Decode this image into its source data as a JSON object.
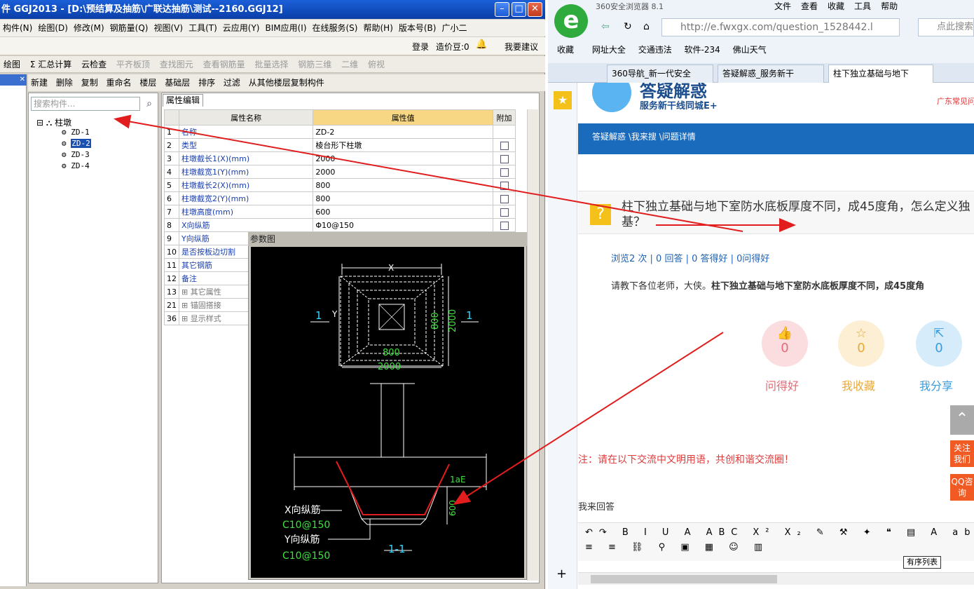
{
  "ggj": {
    "title": "件 GGJ2013 - [D:\\预结算及抽筋\\广联达抽筋\\测试--2160.GGJ12]",
    "menu": [
      "构件(N)",
      "绘图(D)",
      "修改(M)",
      "钢筋量(Q)",
      "视图(V)",
      "工具(T)",
      "云应用(Y)",
      "BIM应用(I)",
      "在线服务(S)",
      "帮助(H)",
      "版本号(B)",
      "广小二"
    ],
    "login": "登录",
    "beans": "造价豆:0",
    "suggest": "我要建议",
    "toolbar1": {
      "draw": "绘图",
      "sum": "Σ 汇总计算",
      "cloud": "云检查",
      "flat": "平齐板顶",
      "find": "查找图元",
      "view_rebar": "查看钢筋量",
      "batch": "批量选择",
      "rebar3d": "钢筋三维",
      "view2d": "二维",
      "view_top": "俯视"
    },
    "toolbar2": {
      "new": "新建",
      "delete": "删除",
      "copy": "复制",
      "rename": "重命名",
      "floor_label": "楼层",
      "floor": "基础层",
      "sort": "排序",
      "filter": "过滤",
      "copy_from": "从其他楼层复制构件"
    },
    "search_placeholder": "搜索构件...",
    "tree": {
      "root": "柱墩",
      "items": [
        "ZD-1",
        "ZD-2",
        "ZD-3",
        "ZD-4"
      ]
    },
    "prop_tab": "属性编辑",
    "headers": [
      "属性名称",
      "属性值",
      "附加"
    ],
    "rows": [
      {
        "n": "1",
        "name": "名称",
        "val": "ZD-2",
        "cb": false
      },
      {
        "n": "2",
        "name": "类型",
        "val": "棱台形下柱墩",
        "cb": true
      },
      {
        "n": "3",
        "name": "柱墩截长1(X)(mm)",
        "val": "2000",
        "cb": true
      },
      {
        "n": "4",
        "name": "柱墩截宽1(Y)(mm)",
        "val": "2000",
        "cb": true
      },
      {
        "n": "5",
        "name": "柱墩截长2(X)(mm)",
        "val": "800",
        "cb": true
      },
      {
        "n": "6",
        "name": "柱墩截宽2(Y)(mm)",
        "val": "800",
        "cb": true
      },
      {
        "n": "7",
        "name": "柱墩高度(mm)",
        "val": "600",
        "cb": true
      },
      {
        "n": "8",
        "name": "X向纵筋",
        "val": "Φ10@150",
        "cb": true
      },
      {
        "n": "9",
        "name": "Y向纵筋",
        "val": "",
        "cb": false
      },
      {
        "n": "10",
        "name": "是否按板边切割",
        "val": "",
        "cb": false
      },
      {
        "n": "11",
        "name": "其它钢筋",
        "val": "",
        "cb": false
      },
      {
        "n": "12",
        "name": "备注",
        "val": "",
        "cb": false
      },
      {
        "n": "13",
        "name": "其它属性",
        "val": "",
        "cb": false,
        "group": true
      },
      {
        "n": "21",
        "name": "锚固搭接",
        "val": "",
        "cb": false,
        "group": true
      },
      {
        "n": "36",
        "name": "显示样式",
        "val": "",
        "cb": false,
        "group": true
      }
    ],
    "dialog": {
      "title": "参数图",
      "dim_x": "X",
      "dim_y": "Y",
      "sec": "1",
      "d800a": "800",
      "d800b": "800",
      "d2000a": "2000",
      "d2000b": "2000",
      "lae": "1aE",
      "h600": "600",
      "xbar": "X向纵筋",
      "xval": "C10@150",
      "ybar": "Y向纵筋",
      "yval": "C10@150",
      "section": "1-1"
    }
  },
  "browser": {
    "app": "360安全浏览器 8.1",
    "menu": [
      "文件",
      "查看",
      "收藏",
      "工具",
      "帮助"
    ],
    "url": "http://e.fwxgx.com/question_1528442.l",
    "search_ph": "点此搜索",
    "bookmarks": [
      "收藏",
      "网址大全",
      "交通违法",
      "软件-234",
      "佛山天气"
    ],
    "tabs": [
      "360导航_新一代安全",
      "答疑解惑_服务新干",
      "柱下独立基础与地下"
    ],
    "site_title": "答疑解惑",
    "site_sub": "服务新干线同城E+",
    "site_right": "广东常见问",
    "breadcrumb": "答疑解惑 \\我来搜 \\问题详情",
    "q_title": "柱下独立基础与地下室防水底板厚度不同，成45度角，怎么定义独基？",
    "stats": "浏览2 次 | 0 回答 | 0 答得好 | 0问得好",
    "desc_plain": "请教下各位老师，大侠。",
    "desc_bold": "柱下独立基础与地下室防水底板厚度不同，成45度角",
    "actions": [
      {
        "icon": "thumb-icon",
        "count": "0",
        "label": "问得好",
        "color": "#e46a74",
        "bg": "#fbdde0"
      },
      {
        "icon": "star-icon",
        "count": "0",
        "label": "我收藏",
        "color": "#e8a93a",
        "bg": "#fcefd3"
      },
      {
        "icon": "share-icon",
        "count": "0",
        "label": "我分享",
        "color": "#3a9bd8",
        "bg": "#d6ecfa"
      }
    ],
    "notice": "注：请在以下交流中文明用语，共创和谐交流圈！",
    "reply": "我来回答",
    "follow": "关注我们",
    "qq": "QQ咨询",
    "tooltip": "有序列表"
  }
}
